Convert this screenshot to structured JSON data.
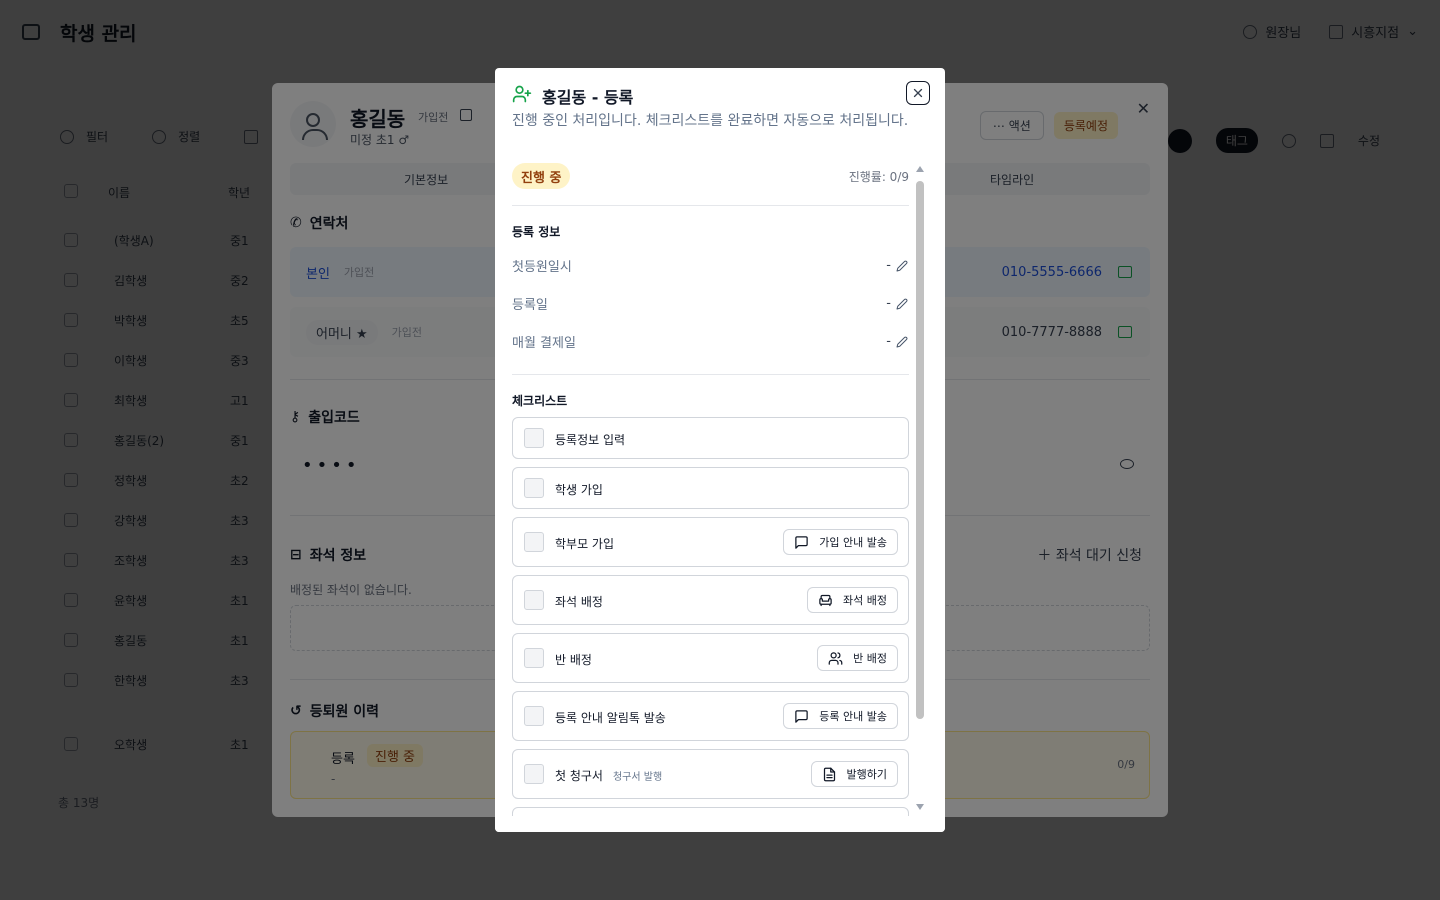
{
  "app": {
    "title": "학생 관리",
    "header_user": "원장님",
    "header_center": "시흥지점",
    "toolbar": {
      "filter": "필터",
      "sort": "정렬"
    },
    "toolbar_right_pill": "태그",
    "toolbar_right_edit": "수정",
    "list_headers": [
      "이름",
      "학년"
    ],
    "rows": [
      {
        "name": "(학생A)",
        "grade": "중1"
      },
      {
        "name": "김학생",
        "grade": "중2"
      },
      {
        "name": "박학생",
        "grade": "초5"
      },
      {
        "name": "이학생",
        "grade": "중3"
      },
      {
        "name": "최학생",
        "grade": "고1"
      },
      {
        "name": "홍길동(2)",
        "grade": "중1"
      },
      {
        "name": "정학생",
        "grade": "초2"
      },
      {
        "name": "강학생",
        "grade": "초3"
      },
      {
        "name": "조학생",
        "grade": "초3"
      },
      {
        "name": "윤학생",
        "grade": "초1"
      },
      {
        "name": "홍길동",
        "grade": "초1"
      },
      {
        "name": "한학생",
        "grade": "초3"
      },
      {
        "name": "오학생",
        "grade": "초1"
      }
    ],
    "list_footer": "총 13명"
  },
  "detail": {
    "name": "홍길동",
    "name_tag": "가입전",
    "sub": "미정 초1 ♂",
    "action_button": "액션",
    "status_badge": "등록예정",
    "tabs": [
      "기본정보",
      "타임라인"
    ],
    "contact_title": "연락처",
    "contacts": [
      {
        "label": "본인",
        "tag": "가입전",
        "phone": "010-5555-6666"
      },
      {
        "label": "어머니 ★",
        "tag": "가입전",
        "phone": "010-7777-8888"
      }
    ],
    "access_code_title": "출입코드",
    "access_code_mask": "••••",
    "seat_title": "좌석 정보",
    "seat_add": "좌석 대기 신청",
    "seat_none": "배정된 좌석이 없습니다.",
    "history_title": "등퇴원 이력",
    "history_item": {
      "type": "등록",
      "status": "진행 중",
      "date": "-",
      "progress": "0/9"
    }
  },
  "modal": {
    "title": "홍길동 - 등록",
    "description": "진행 중인 처리입니다. 체크리스트를 완료하면 자동으로 처리됩니다.",
    "status": "진행 중",
    "progress_text": "진행률: 0/9",
    "progress_value": 0,
    "progress_total": 9,
    "info_section": "등록 정보",
    "info_rows": [
      {
        "label": "첫등원일시",
        "value": "-"
      },
      {
        "label": "등록일",
        "value": "-"
      },
      {
        "label": "매월 결제일",
        "value": "-"
      }
    ],
    "checklist_section": "체크리스트",
    "checklist": [
      {
        "label": "등록정보 입력",
        "sub": "",
        "button": "",
        "icon": ""
      },
      {
        "label": "학생 가입",
        "sub": "",
        "button": "",
        "icon": ""
      },
      {
        "label": "학부모 가입",
        "sub": "",
        "button": "가입 안내 발송",
        "icon": "message-icon"
      },
      {
        "label": "좌석 배정",
        "sub": "",
        "button": "좌석 배정",
        "icon": "seat-icon"
      },
      {
        "label": "반 배정",
        "sub": "",
        "button": "반 배정",
        "icon": "users-icon"
      },
      {
        "label": "등록 안내 알림톡 발송",
        "sub": "",
        "button": "등록 안내 발송",
        "icon": "message-icon"
      },
      {
        "label": "첫 청구서",
        "sub": "청구서 발행",
        "button": "발행하기",
        "icon": "document-icon"
      }
    ],
    "colors": {
      "accent_green": "#16a34a",
      "badge_bg": "#fef3c7",
      "badge_text": "#92400e",
      "muted": "#64748b"
    }
  }
}
